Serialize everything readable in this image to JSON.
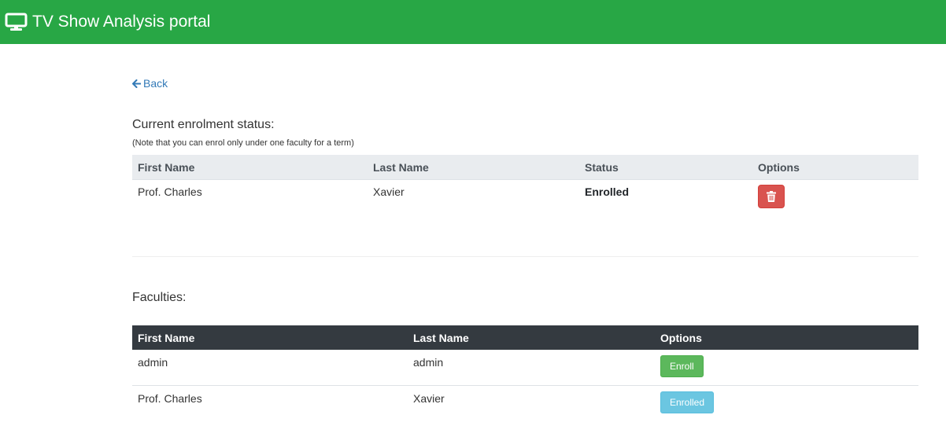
{
  "navbar": {
    "brand_icon": "monitor-icon",
    "title": "TV Show Analysis portal",
    "color": "#28a745"
  },
  "back": {
    "icon": "arrow-left-icon",
    "label": "Back",
    "color": "#337ab7"
  },
  "enrolment": {
    "title": "Current enrolment status:",
    "note": "(Note that you can enrol only under one faculty for a term)",
    "columns": [
      "First Name",
      "Last Name",
      "Status",
      "Options"
    ],
    "rows": [
      {
        "first_name": "Prof. Charles",
        "last_name": "Xavier",
        "status": "Enrolled",
        "option_icon": "trash-icon"
      }
    ]
  },
  "faculties": {
    "title": "Faculties:",
    "columns": [
      "First Name",
      "Last Name",
      "Options"
    ],
    "rows": [
      {
        "first_name": "admin",
        "last_name": "admin",
        "option_label": "Enroll"
      },
      {
        "first_name": "Prof. Charles",
        "last_name": "Xavier",
        "option_label": "Enrolled"
      }
    ]
  }
}
